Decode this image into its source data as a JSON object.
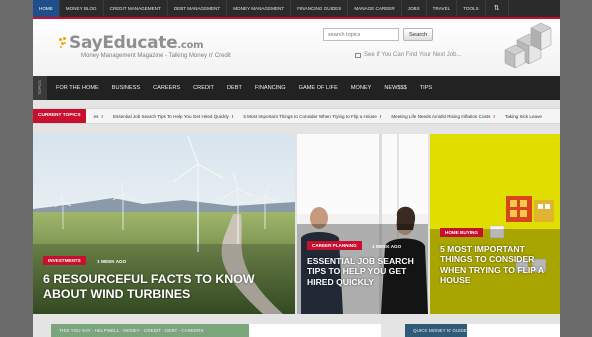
{
  "topnav": {
    "items": [
      "Home",
      "Money Blog",
      "Credit Management",
      "Debt Management",
      "Money Management",
      "Financing Guides",
      "Manage Career",
      "Jobs",
      "Travel",
      "Tools"
    ],
    "more_icon": "⇅"
  },
  "header": {
    "logo_main": "SayEducate",
    "logo_suffix": ".com",
    "tagline": "Money Management Magazine - Talking Money n' Credit",
    "search_placeholder": "search topics",
    "search_button": "Search",
    "see_if": "See If You Can Find Your Next Job..."
  },
  "mainnav": {
    "topics_tab": "TOPICS",
    "items": [
      "For The Home",
      "Business",
      "Careers",
      "Credit",
      "Debt",
      "Financing",
      "Game of Life",
      "Money",
      "New$$$",
      "Tips"
    ]
  },
  "ticker": {
    "label": "Current Topics",
    "items": [
      "es",
      "Essential Job Search Tips To Help You Get Hired Quickly",
      "5 Most Important Things to Consider When Trying to Flip a House",
      "Meeting Life Needs Amidst Rising Inflation Costs",
      "Taking Sick Leave"
    ],
    "mark": "!"
  },
  "hero": [
    {
      "tag": "Investments",
      "ago": "1 week ago",
      "title": "6 Resourceful Facts to Know About Wind Turbines"
    },
    {
      "tag": "Career Planning",
      "ago": "1 week ago",
      "title": "Essential Job Search Tips to Help You Get Hired Quickly"
    },
    {
      "tag": "Home Buying",
      "ago": "",
      "title": "5 Most Important Things to Consider When Trying to Flip a House"
    }
  ],
  "bottom": {
    "left_bar": "This you say - Helpwell - Money - Credit - Debt - Careers",
    "right_bar": "Quick Money N' Guides"
  },
  "colors": {
    "accent": "#c8102e",
    "nav_dark": "#222222",
    "active_blue": "#1f4f8a"
  }
}
